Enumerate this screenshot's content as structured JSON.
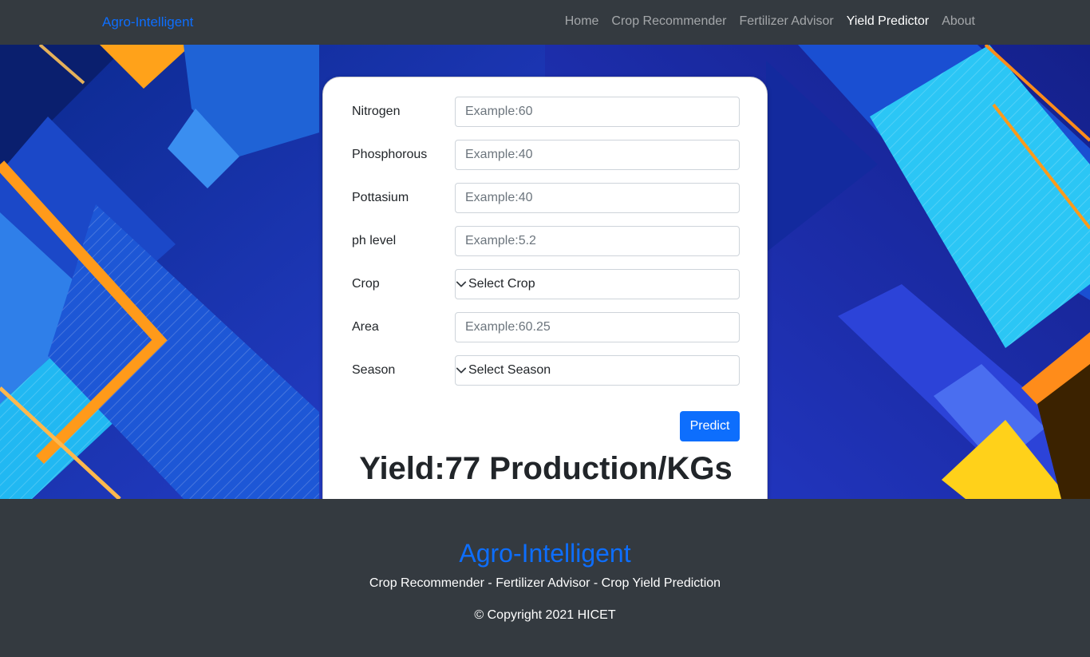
{
  "navbar": {
    "brand": "Agro-Intelligent",
    "items": [
      {
        "label": "Home",
        "active": false
      },
      {
        "label": "Crop Recommender",
        "active": false
      },
      {
        "label": "Fertilizer Advisor",
        "active": false
      },
      {
        "label": "Yield Predictor",
        "active": true
      },
      {
        "label": "About",
        "active": false
      }
    ]
  },
  "form": {
    "fields": [
      {
        "label": "Nitrogen",
        "placeholder": "Example:60",
        "value": ""
      },
      {
        "label": "Phosphorous",
        "placeholder": "Example:40",
        "value": ""
      },
      {
        "label": "Pottasium",
        "placeholder": "Example:40",
        "value": ""
      },
      {
        "label": "ph level",
        "placeholder": "Example:5.2",
        "value": ""
      },
      {
        "label": "Crop",
        "selected": "Select Crop"
      },
      {
        "label": "Area",
        "placeholder": "Example:60.25",
        "value": ""
      },
      {
        "label": "Season",
        "selected": "Select Season"
      }
    ],
    "submit_label": "Predict",
    "result": "Yield:77 Production/KGs"
  },
  "footer": {
    "title": "Agro-Intelligent",
    "subtitle": "Crop Recommender - Fertilizer Advisor - Crop Yield Prediction",
    "copyright": "© Copyright 2021 HICET"
  },
  "colors": {
    "navbar_bg": "#343a40",
    "brand": "#0d6efd",
    "primary_button": "#0d6efd",
    "card_bg": "#ffffff"
  },
  "icons": {
    "select_arrow": "chevron-down-icon"
  }
}
